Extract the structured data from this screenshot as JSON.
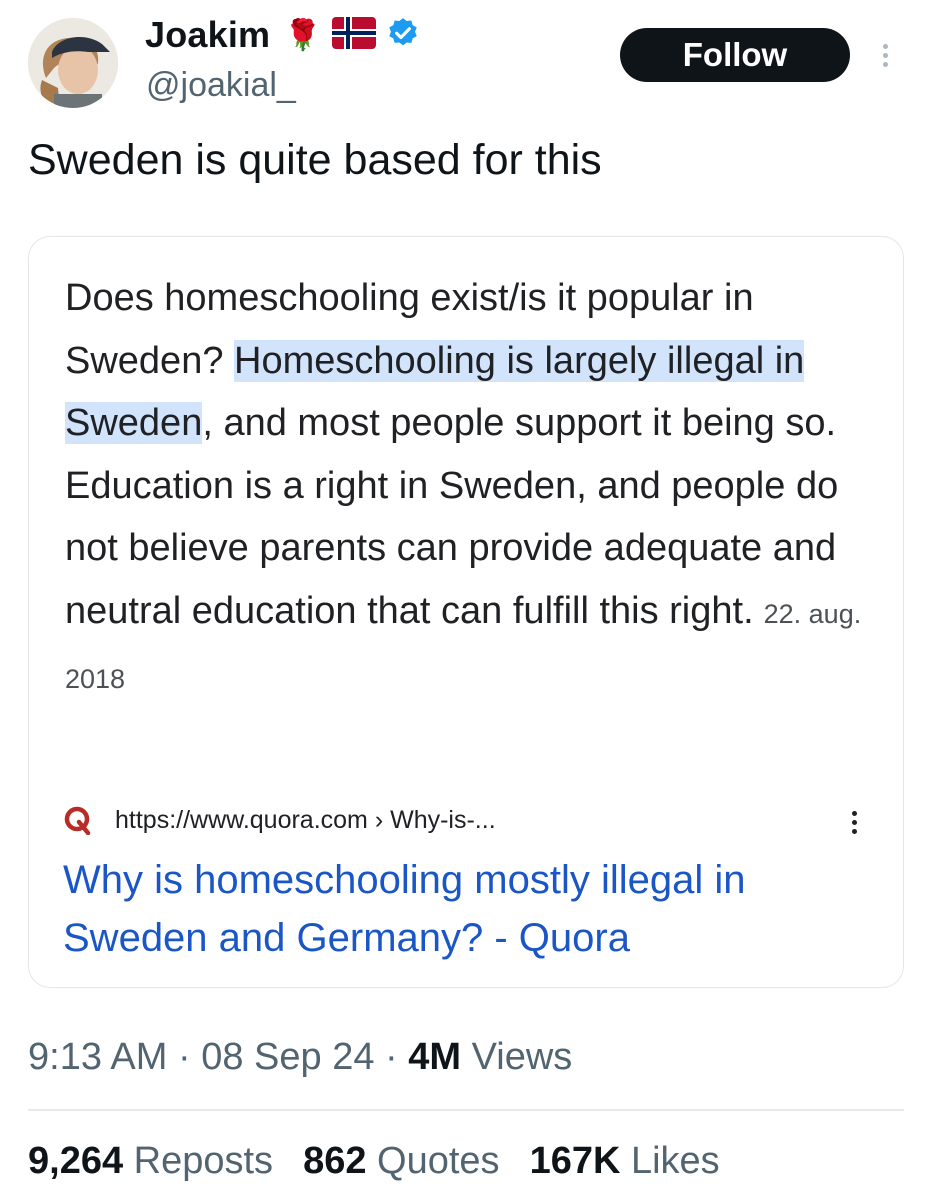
{
  "author": {
    "name": "Joakim",
    "handle": "@joakial_",
    "emoji_rose": "🌹",
    "flag": "norway-flag",
    "verified_icon": "verified-badge-icon",
    "verified_color": "#1d9bf0"
  },
  "follow_label": "Follow",
  "tweet": {
    "text": "Sweden is quite based for this"
  },
  "card": {
    "snippet_before": "Does homeschooling exist/is it popular in Sweden? ",
    "snippet_highlight": "Homeschooling is largely illegal in Sweden",
    "snippet_after": ", and most people support it being so. Education is a right in Sweden, and people do not believe parents can provide adequate and neutral education that can fulfill this right.",
    "date": "22. aug. 2018",
    "source_url": "https://www.quora.com › Why-is-...",
    "source_icon": "quora-logo-icon",
    "title": "Why is homeschooling mostly illegal in Sweden and Germany? - Quora",
    "highlight_color": "#d2e3fc",
    "link_color": "#1a56c6"
  },
  "meta": {
    "time": "9:13 AM",
    "sep": "·",
    "date": "08 Sep 24",
    "views_count": "4M",
    "views_label": "Views"
  },
  "stats": {
    "reposts_count": "9,264",
    "reposts_label": "Reposts",
    "quotes_count": "862",
    "quotes_label": "Quotes",
    "likes_count": "167K",
    "likes_label": "Likes"
  }
}
